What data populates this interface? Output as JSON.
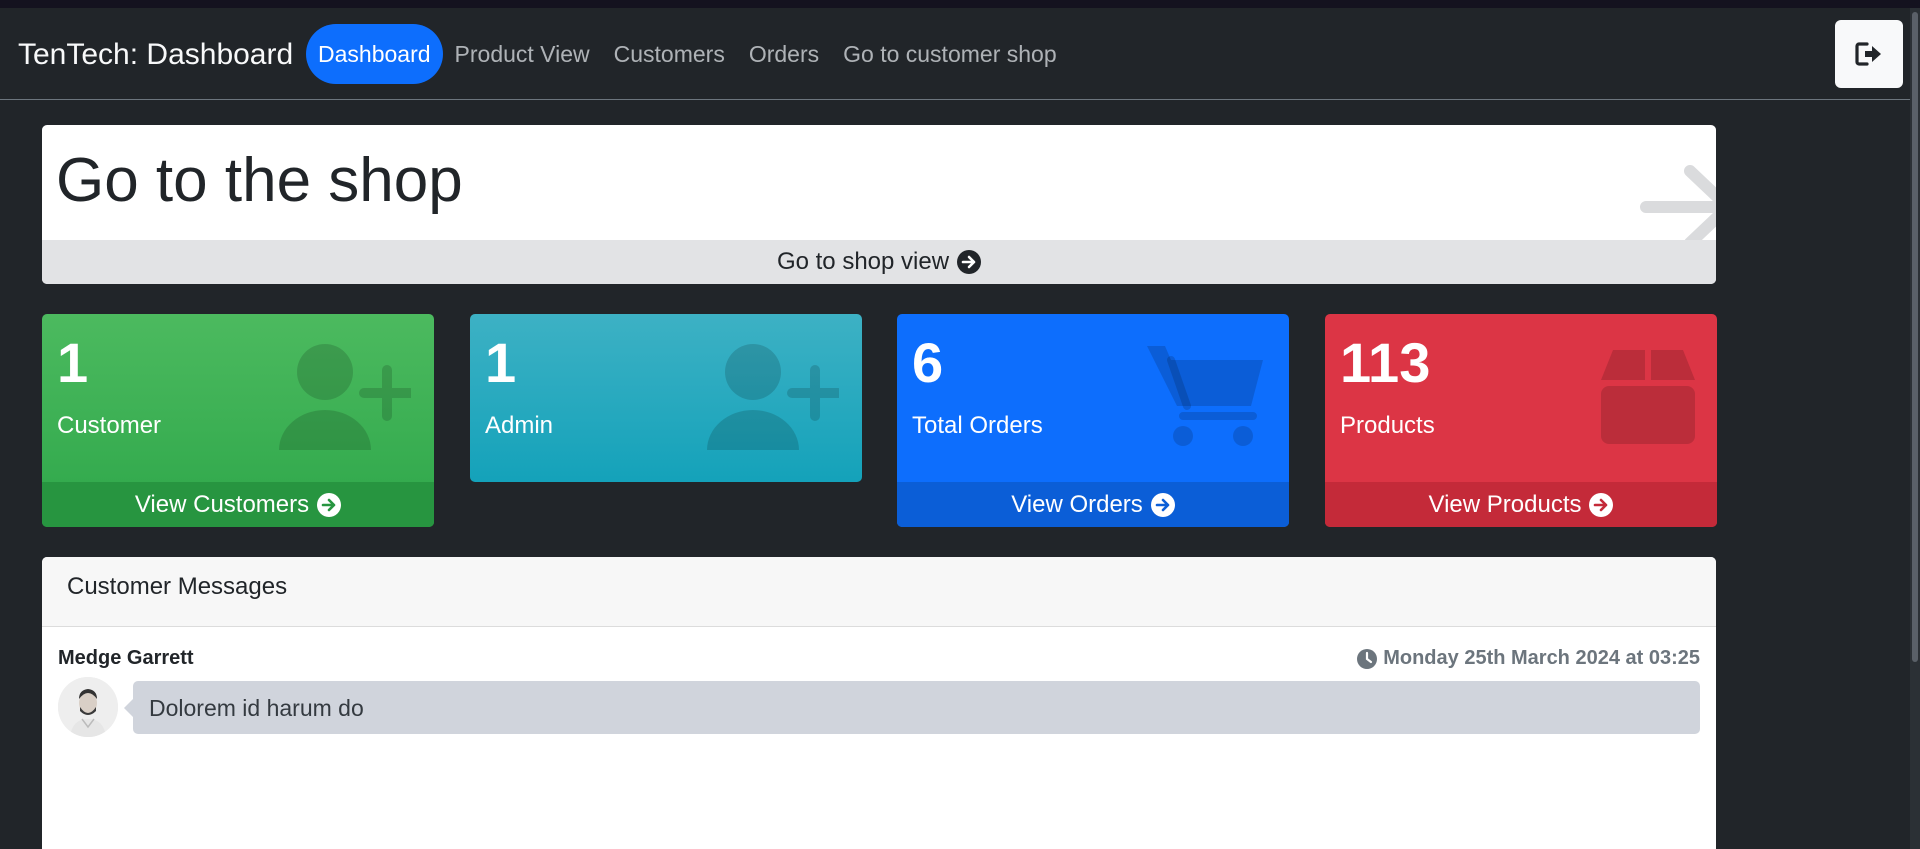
{
  "brand": "TenTech: Dashboard",
  "nav": {
    "items": [
      "Dashboard",
      "Product View",
      "Customers",
      "Orders",
      "Go to customer shop"
    ],
    "active": "Dashboard"
  },
  "shop_banner": {
    "title": "Go to the shop",
    "link_label": "Go to shop view"
  },
  "stats": {
    "customers": {
      "count": "1",
      "label": "Customer",
      "link": "View Customers",
      "color": "#28a745"
    },
    "admins": {
      "count": "1",
      "label": "Admin",
      "color": "#17a2b8"
    },
    "orders": {
      "count": "6",
      "label": "Total Orders",
      "link": "View Orders",
      "color": "#0d6efd"
    },
    "products": {
      "count": "113",
      "label": "Products",
      "link": "View Products",
      "color": "#dc3545"
    }
  },
  "messages": {
    "title": "Customer Messages",
    "items": [
      {
        "author": "Medge Garrett",
        "timestamp": "Monday 25th March 2024 at 03:25",
        "text": "Dolorem id harum do"
      }
    ]
  },
  "icons": {
    "logout": "logout-icon",
    "arrow": "arrow-right-icon",
    "clock": "clock-icon"
  }
}
